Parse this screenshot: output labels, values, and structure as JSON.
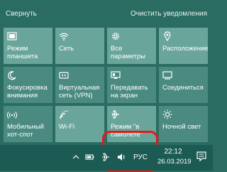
{
  "header": {
    "collapse_label": "Свернуть",
    "clear_label": "Очистить уведомления"
  },
  "tiles": [
    {
      "label": "Режим планшета",
      "icon": "tablet-mode-icon",
      "active": true
    },
    {
      "label": "Сеть",
      "icon": "network-icon",
      "active": true
    },
    {
      "label": "Все параметры",
      "icon": "gear-icon",
      "active": true
    },
    {
      "label": "Расположение",
      "icon": "location-icon",
      "active": true
    },
    {
      "label": "Фокусировка внимания",
      "icon": "focus-assist-icon",
      "active": false
    },
    {
      "label": "Виртуальная сеть (VPN)",
      "icon": "vpn-icon",
      "active": false
    },
    {
      "label": "Передавать на экран",
      "icon": "project-icon",
      "active": false
    },
    {
      "label": "Соединиться",
      "icon": "connect-icon",
      "active": false
    },
    {
      "label": "Мобильный хот-спот",
      "icon": "hotspot-icon",
      "active": false
    },
    {
      "label": "Wi-Fi",
      "icon": "wifi-icon",
      "active": true
    },
    {
      "label": "Режим \"в самолете\"",
      "icon": "airplane-icon",
      "active": true
    },
    {
      "label": "Ночной свет",
      "icon": "night-light-icon",
      "active": false
    }
  ],
  "taskbar": {
    "language": "РУС",
    "time": "22:12",
    "date": "26.03.2019"
  },
  "colors": {
    "panel_bg": "#2a6c62",
    "tile_bg": "#4a8a80",
    "tile_active_bg": "#6aa59b",
    "taskbar_bg": "#1b5b53",
    "highlight": "#e21a1a"
  }
}
